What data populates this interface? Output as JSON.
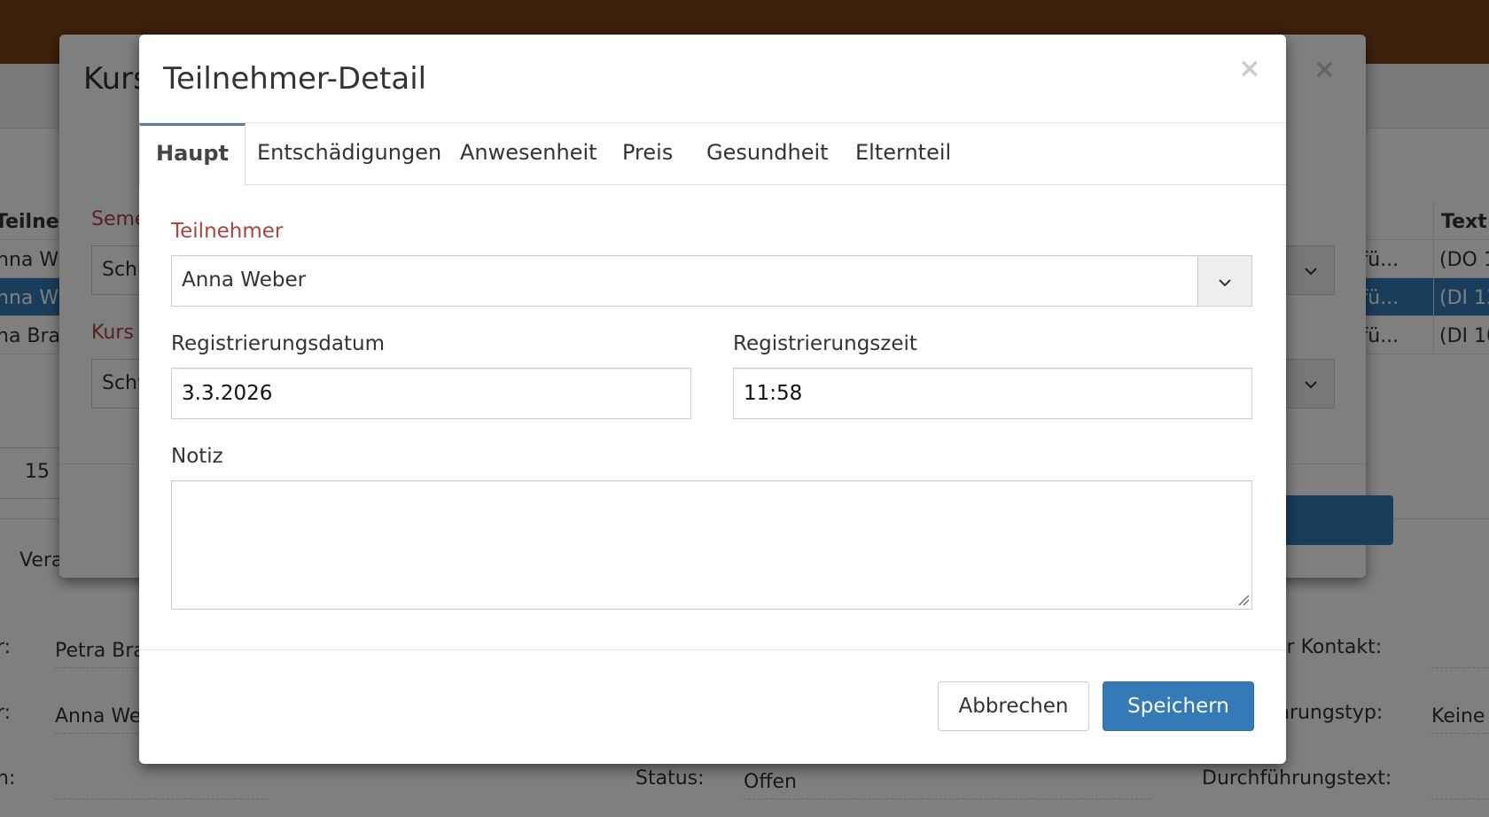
{
  "background": {
    "table_header": {
      "col1": "Teilneh",
      "col_text": "Text"
    },
    "table_rows": [
      {
        "name": "nna W",
        "course": "rs fü...",
        "text": "(DO 1"
      },
      {
        "name": "nna W",
        "course": "rs fü...",
        "text": "(DI 13"
      },
      {
        "name": "na Bra",
        "course": "rs fü...",
        "text": "(DI 10"
      }
    ],
    "pager_value": "15",
    "bottom_tab": "Vera",
    "details": {
      "label_1": "r:",
      "value_1": "Petra Bra",
      "label_2": "r:",
      "value_2": "Anna We",
      "label_3": "n:",
      "status_label": "Status:",
      "status_value": "Offen",
      "contact_label": "er Kontakt:",
      "type_label": "hrungstyp:",
      "type_value": "Keine",
      "text_label": "Durchführungstext:"
    }
  },
  "outer_modal": {
    "title": "Kurs",
    "close_symbol": "×",
    "semester_label": "Seme",
    "semester_value": "Schu",
    "kurs_label": "Kurs",
    "kurs_value": "Schw"
  },
  "modal": {
    "title": "Teilnehmer-Detail",
    "close_symbol": "×",
    "tabs": [
      "Haupt",
      "Entschädigungen",
      "Anwesenheit",
      "Preis",
      "Gesundheit",
      "Elternteil"
    ],
    "fields": {
      "teilnehmer_label": "Teilnehmer",
      "teilnehmer_value": "Anna Weber",
      "date_label": "Registrierungsdatum",
      "date_value": "3.3.2026",
      "time_label": "Registrierungszeit",
      "time_value": "11:58",
      "note_label": "Notiz",
      "note_value": ""
    },
    "buttons": {
      "cancel": "Abbrechen",
      "save": "Speichern"
    }
  },
  "colors": {
    "topbar": "#7a4218",
    "primary": "#337ab7",
    "required_label": "#a94442",
    "active_tab_indicator": "#5b7a96"
  }
}
